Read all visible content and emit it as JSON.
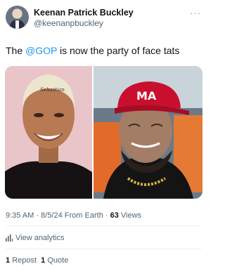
{
  "author": {
    "display_name": "Keenan Patrick Buckley",
    "handle": "@keenanpbuckley"
  },
  "tweet": {
    "text_before": "The ",
    "mention": "@GOP",
    "text_after": " is now the party of face tats"
  },
  "media": {
    "left_image": "photo-woman-face-tattoo",
    "right_image": "photo-man-face-tattoos-red-cap",
    "cap_text": "MA"
  },
  "meta": {
    "time": "9:35 AM",
    "date": "8/5/24",
    "source": "From Earth",
    "views_count": "63",
    "views_label": "Views"
  },
  "analytics": {
    "label": "View analytics",
    "icon": "bar-chart-icon"
  },
  "stats": {
    "reposts_count": "1",
    "reposts_label": "Repost",
    "quotes_count": "1",
    "quotes_label": "Quote"
  },
  "colors": {
    "accent": "#1d9bf0",
    "secondary_text": "#536471",
    "cap_red": "#c8102e"
  }
}
